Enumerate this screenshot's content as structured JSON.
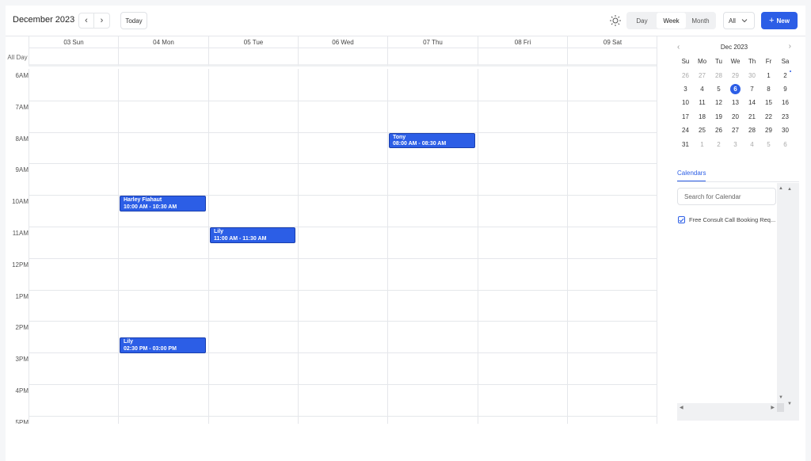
{
  "header": {
    "title": "December 2023",
    "today_label": "Today",
    "views": [
      "Day",
      "Week",
      "Month"
    ],
    "active_view": "Week",
    "filter_value": "All",
    "new_label": "New"
  },
  "grid": {
    "days": [
      "03 Sun",
      "04 Mon",
      "05 Tue",
      "06 Wed",
      "07 Thu",
      "08 Fri",
      "09 Sat"
    ],
    "all_day_label": "All Day",
    "hours": [
      "6AM",
      "7AM",
      "8AM",
      "9AM",
      "10AM",
      "11AM",
      "12PM",
      "1PM",
      "2PM",
      "3PM",
      "4PM",
      "5PM"
    ],
    "events": [
      {
        "title": "Tony",
        "time": "08:00 AM - 08:30 AM",
        "day": 4,
        "start": 8.0,
        "end": 8.5
      },
      {
        "title": "Harley Fiahaut",
        "time": "10:00 AM - 10:30 AM",
        "day": 1,
        "start": 10.0,
        "end": 10.5
      },
      {
        "title": "Lily",
        "time": "11:00 AM - 11:30 AM",
        "day": 2,
        "start": 11.0,
        "end": 11.5
      },
      {
        "title": "Lily",
        "time": "02:30 PM - 03:00 PM",
        "day": 1,
        "start": 14.5,
        "end": 15.0
      }
    ]
  },
  "sidebar": {
    "mini_title": "Dec 2023",
    "weekdays": [
      "Su",
      "Mo",
      "Tu",
      "We",
      "Th",
      "Fr",
      "Sa"
    ],
    "weeks": [
      [
        "26",
        "27",
        "28",
        "29",
        "30",
        "1",
        "2"
      ],
      [
        "3",
        "4",
        "5",
        "6",
        "7",
        "8",
        "9"
      ],
      [
        "10",
        "11",
        "12",
        "13",
        "14",
        "15",
        "16"
      ],
      [
        "17",
        "18",
        "19",
        "20",
        "21",
        "22",
        "23"
      ],
      [
        "24",
        "25",
        "26",
        "27",
        "28",
        "29",
        "30"
      ],
      [
        "31",
        "1",
        "2",
        "3",
        "4",
        "5",
        "6"
      ]
    ],
    "today": "6",
    "calendars_tab": "Calendars",
    "search_placeholder": "Search for Calendar",
    "calendar_items": [
      "Free Consult Call Booking Req..."
    ]
  },
  "colors": {
    "accent": "#2c5ee6"
  }
}
